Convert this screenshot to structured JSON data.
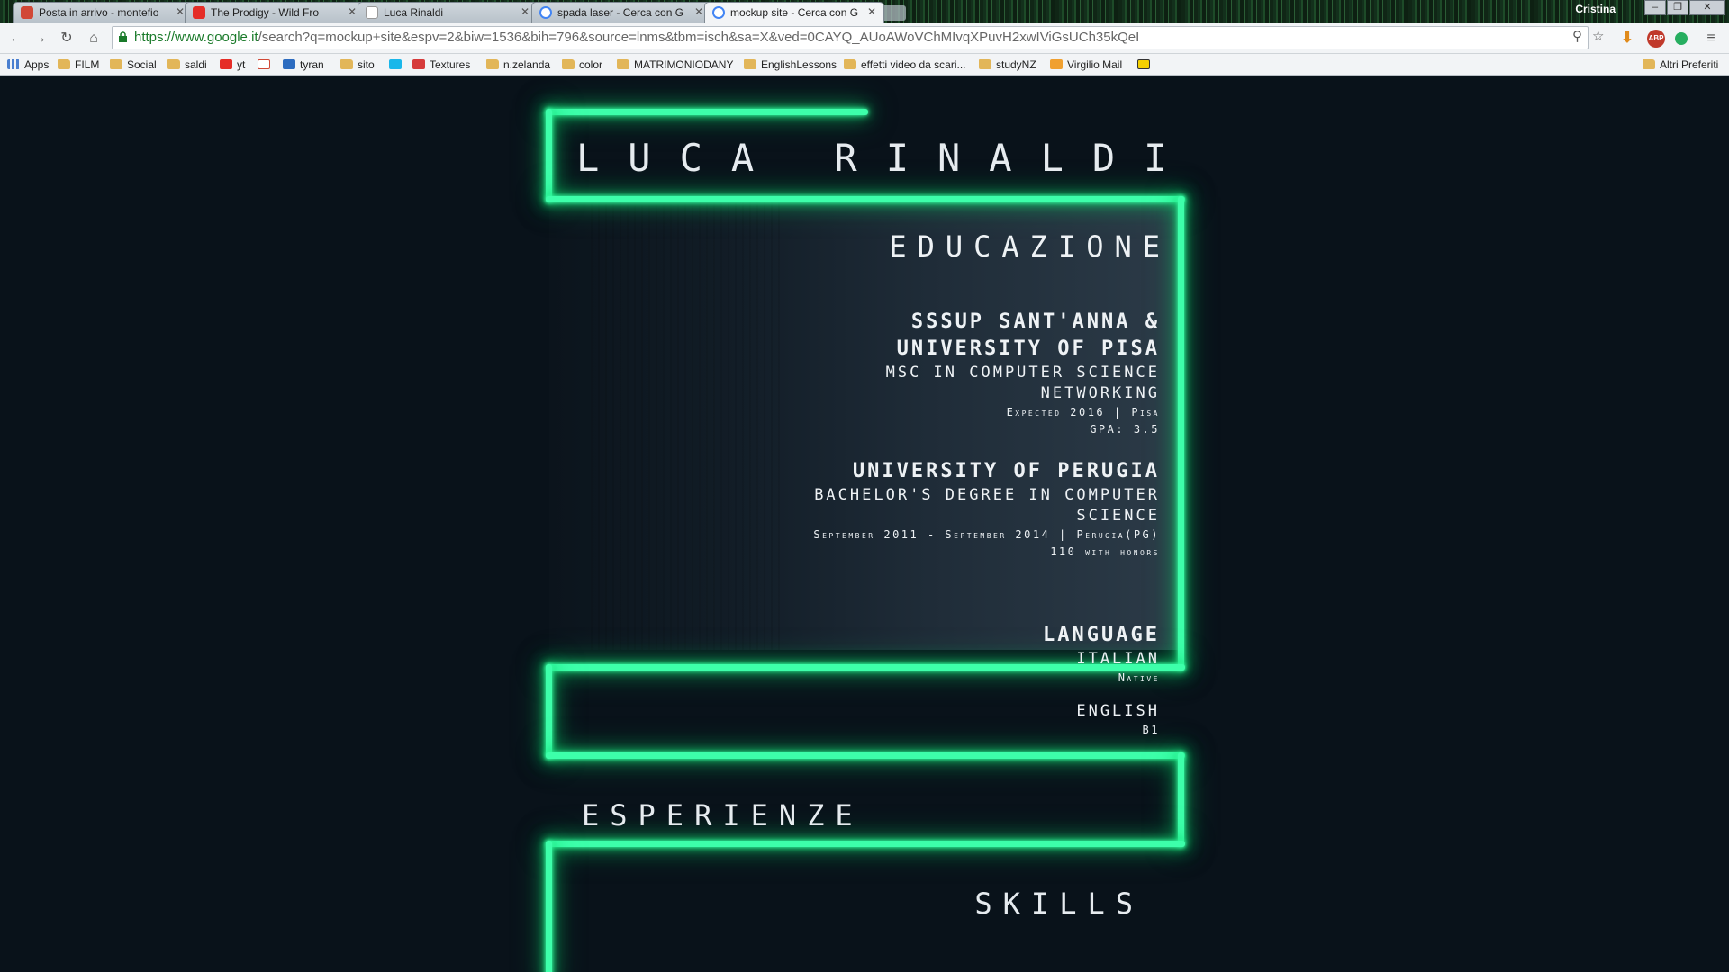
{
  "browser": {
    "tabs": [
      {
        "label": "Posta in arrivo - montefio",
        "favicon_color": "#d14836"
      },
      {
        "label": "The Prodigy - Wild Fro",
        "favicon_color": "#e52d27"
      },
      {
        "label": "Luca Rinaldi",
        "favicon_color": "#9aa3ab"
      },
      {
        "label": "spada laser - Cerca con G",
        "favicon_color": "#4285f4"
      },
      {
        "label": "mockup site - Cerca con G",
        "favicon_color": "#4285f4"
      }
    ],
    "user": "Cristina",
    "url_domain": "https://www.google.it",
    "url_path": "/search?q=mockup+site&espv=2&biw=1536&bih=796&source=lnms&tbm=isch&sa=X&ved=0CAYQ_AUoAWoVChMIvqXPuvH2xwIViGsUCh35kQeI",
    "extensions": [
      {
        "name": "ABP",
        "color": "#c0392b"
      }
    ],
    "bookmarks": [
      {
        "label": "Apps",
        "icon": "apps-icon"
      },
      {
        "label": "FILM",
        "icon": "folder-icon"
      },
      {
        "label": "Social",
        "icon": "folder-icon"
      },
      {
        "label": "saldi",
        "icon": "folder-icon"
      },
      {
        "label": "yt",
        "icon": "youtube-icon"
      },
      {
        "label": "",
        "icon": "gmail-icon"
      },
      {
        "label": "tyran",
        "icon": "outlook-icon"
      },
      {
        "label": "sito",
        "icon": "folder-icon"
      },
      {
        "label": "",
        "icon": "vimeo-icon"
      },
      {
        "label": "Textures",
        "icon": "textures-icon"
      },
      {
        "label": "n.zelanda",
        "icon": "folder-icon"
      },
      {
        "label": "color",
        "icon": "folder-icon"
      },
      {
        "label": "MATRIMONIODANY",
        "icon": "folder-icon"
      },
      {
        "label": "EnglishLessons",
        "icon": "folder-icon"
      },
      {
        "label": "effetti video da scari...",
        "icon": "folder-icon"
      },
      {
        "label": "studyNZ",
        "icon": "folder-icon"
      },
      {
        "label": "Virgilio Mail",
        "icon": "virgilio-icon"
      },
      {
        "label": "",
        "icon": "norton-icon"
      }
    ],
    "other_bookmarks": "Altri Preferiti"
  },
  "page": {
    "name": "LUCA RINALDI",
    "education": {
      "heading": "EDUCAZIONE",
      "entries": [
        {
          "institution_line1": "SSSUP SANT'ANNA &",
          "institution_line2": "UNIVERSITY OF PISA",
          "degree_line1": "MSC IN COMPUTER SCIENCE",
          "degree_line2": "NETWORKING",
          "detail1": "Expected 2016 | Pisa",
          "detail2": "GPA: 3.5"
        },
        {
          "institution_line1": "UNIVERSITY OF PERUGIA",
          "degree_line1": "BACHELOR'S DEGREE IN COMPUTER",
          "degree_line2": "SCIENCE",
          "detail1": "September 2011 - September 2014 | Perugia(PG)",
          "detail2": "110 with honors"
        }
      ]
    },
    "language": {
      "heading": "LANGUAGE",
      "items": [
        {
          "name": "ITALIAN",
          "level": "Native"
        },
        {
          "name": "ENGLISH",
          "level": "B1"
        }
      ]
    },
    "experience_heading": "ESPERIENZE",
    "skills_heading": "SKILLS",
    "accent_color": "#3dffaa"
  }
}
